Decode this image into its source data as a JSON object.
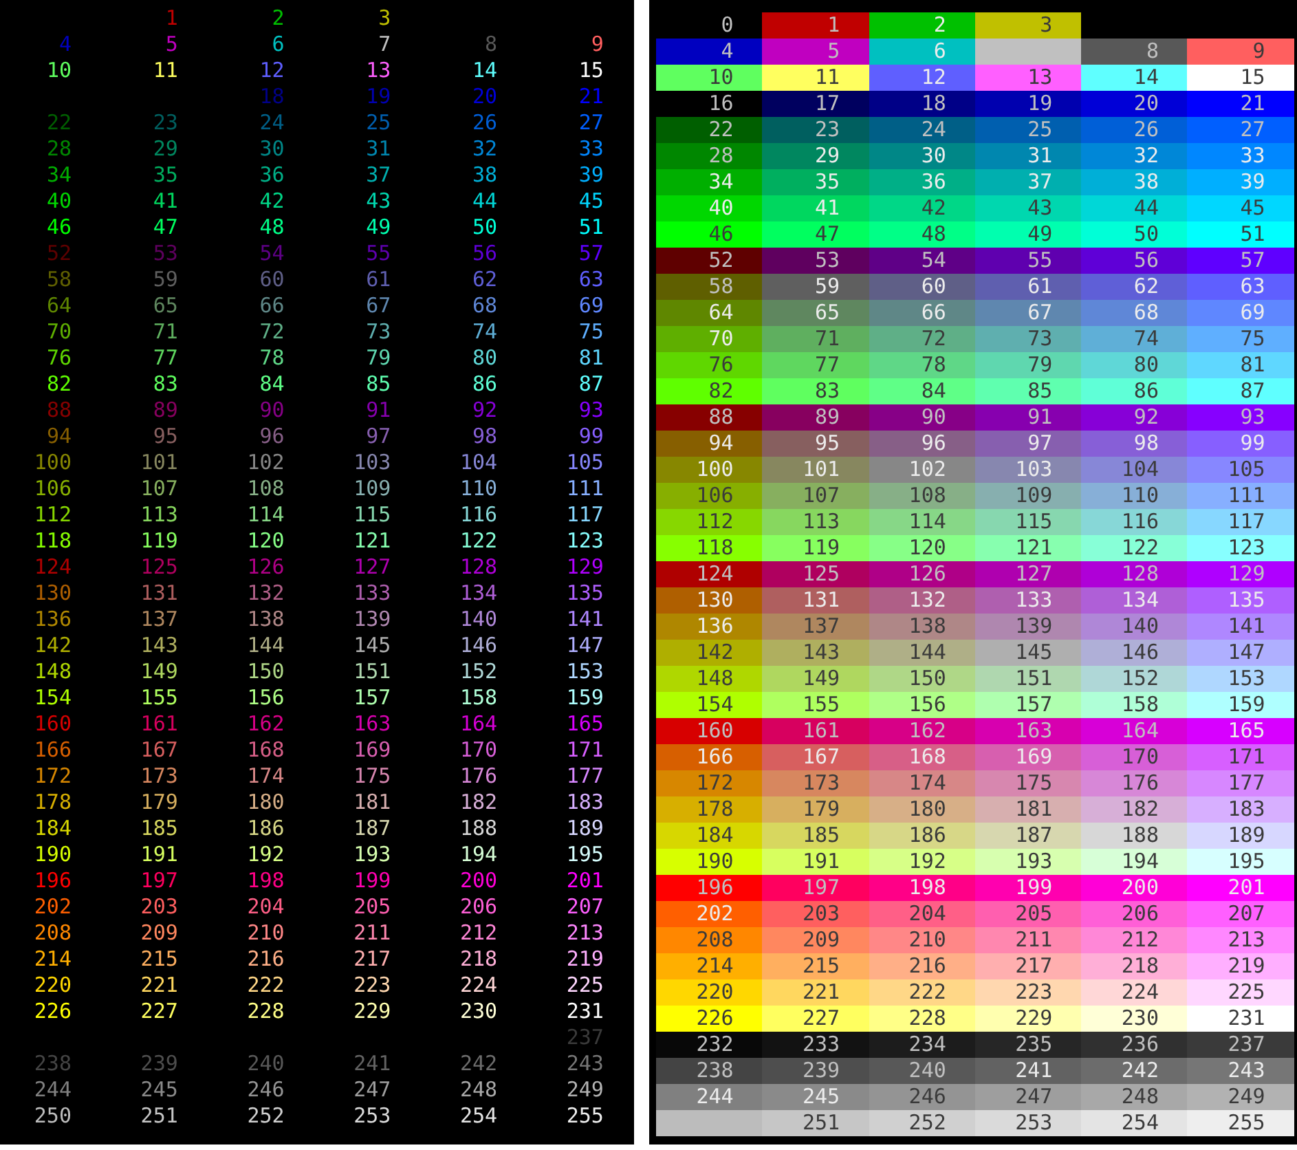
{
  "foreground_panel": {
    "cells": [
      null,
      {
        "text": "1",
        "color": "#c00000"
      },
      {
        "text": "2",
        "color": "#00c000"
      },
      {
        "text": "3",
        "color": "#c0c000"
      },
      {
        "text": "4",
        "color": "#0000c0"
      },
      {
        "text": "5",
        "color": "#c000c0"
      },
      {
        "text": "6",
        "color": "#00c0c0"
      },
      {
        "text": "7",
        "color": "#c0c0c0"
      },
      {
        "text": "8",
        "color": "#585858"
      },
      {
        "text": "9",
        "color": "#ff5f5f"
      },
      {
        "text": "10",
        "color": "#5fff5f"
      },
      {
        "text": "11",
        "color": "#ffff5f"
      },
      {
        "text": "12",
        "color": "#5f5fff"
      },
      {
        "text": "13",
        "color": "#ff5fff"
      },
      {
        "text": "14",
        "color": "#5fffff"
      },
      {
        "text": "15",
        "color": "#ffffff"
      },
      null,
      null,
      {
        "text": "18",
        "color": "#000087"
      },
      {
        "text": "19",
        "color": "#0000af"
      },
      {
        "text": "20",
        "color": "#0000d7"
      },
      {
        "text": "21",
        "color": "#0000ff"
      },
      {
        "text": "22",
        "color": "#005f00"
      },
      {
        "text": "23",
        "color": "#005f5f"
      },
      {
        "text": "24",
        "color": "#005f87"
      },
      {
        "text": "25",
        "color": "#005faf"
      },
      {
        "text": "26",
        "color": "#005fd7"
      },
      {
        "text": "27",
        "color": "#005fff"
      },
      {
        "text": "28",
        "color": "#008700"
      },
      {
        "text": "29",
        "color": "#00875f"
      },
      {
        "text": "30",
        "color": "#008787"
      },
      {
        "text": "31",
        "color": "#0087af"
      },
      {
        "text": "32",
        "color": "#0087d7"
      },
      {
        "text": "33",
        "color": "#0087ff"
      },
      {
        "text": "34",
        "color": "#00af00"
      },
      {
        "text": "35",
        "color": "#00af5f"
      },
      {
        "text": "36",
        "color": "#00af87"
      },
      {
        "text": "37",
        "color": "#00afaf"
      },
      {
        "text": "38",
        "color": "#00afd7"
      },
      {
        "text": "39",
        "color": "#00afff"
      },
      {
        "text": "40",
        "color": "#00d700"
      },
      {
        "text": "41",
        "color": "#00d75f"
      },
      {
        "text": "42",
        "color": "#00d787"
      },
      {
        "text": "43",
        "color": "#00d7af"
      },
      {
        "text": "44",
        "color": "#00d7d7"
      },
      {
        "text": "45",
        "color": "#00d7ff"
      },
      {
        "text": "46",
        "color": "#00ff00"
      },
      {
        "text": "47",
        "color": "#00ff5f"
      },
      {
        "text": "48",
        "color": "#00ff87"
      },
      {
        "text": "49",
        "color": "#00ffaf"
      },
      {
        "text": "50",
        "color": "#00ffd7"
      },
      {
        "text": "51",
        "color": "#00ffff"
      },
      {
        "text": "52",
        "color": "#5f0000"
      },
      {
        "text": "53",
        "color": "#5f005f"
      },
      {
        "text": "54",
        "color": "#5f0087"
      },
      {
        "text": "55",
        "color": "#5f00af"
      },
      {
        "text": "56",
        "color": "#5f00d7"
      },
      {
        "text": "57",
        "color": "#5f00ff"
      },
      {
        "text": "58",
        "color": "#5f5f00"
      },
      {
        "text": "59",
        "color": "#5f5f5f"
      },
      {
        "text": "60",
        "color": "#5f5f87"
      },
      {
        "text": "61",
        "color": "#5f5faf"
      },
      {
        "text": "62",
        "color": "#5f5fd7"
      },
      {
        "text": "63",
        "color": "#5f5fff"
      },
      {
        "text": "64",
        "color": "#5f8700"
      },
      {
        "text": "65",
        "color": "#5f875f"
      },
      {
        "text": "66",
        "color": "#5f8787"
      },
      {
        "text": "67",
        "color": "#5f87af"
      },
      {
        "text": "68",
        "color": "#5f87d7"
      },
      {
        "text": "69",
        "color": "#5f87ff"
      },
      {
        "text": "70",
        "color": "#5faf00"
      },
      {
        "text": "71",
        "color": "#5faf5f"
      },
      {
        "text": "72",
        "color": "#5faf87"
      },
      {
        "text": "73",
        "color": "#5fafaf"
      },
      {
        "text": "74",
        "color": "#5fafd7"
      },
      {
        "text": "75",
        "color": "#5fafff"
      },
      {
        "text": "76",
        "color": "#5fd700"
      },
      {
        "text": "77",
        "color": "#5fd75f"
      },
      {
        "text": "78",
        "color": "#5fd787"
      },
      {
        "text": "79",
        "color": "#5fd7af"
      },
      {
        "text": "80",
        "color": "#5fd7d7"
      },
      {
        "text": "81",
        "color": "#5fd7ff"
      },
      {
        "text": "82",
        "color": "#5fff00"
      },
      {
        "text": "83",
        "color": "#5fff5f"
      },
      {
        "text": "84",
        "color": "#5fff87"
      },
      {
        "text": "85",
        "color": "#5fffaf"
      },
      {
        "text": "86",
        "color": "#5fffd7"
      },
      {
        "text": "87",
        "color": "#5fffff"
      },
      {
        "text": "88",
        "color": "#870000"
      },
      {
        "text": "89",
        "color": "#87005f"
      },
      {
        "text": "90",
        "color": "#870087"
      },
      {
        "text": "91",
        "color": "#8700af"
      },
      {
        "text": "92",
        "color": "#8700d7"
      },
      {
        "text": "93",
        "color": "#8700ff"
      },
      {
        "text": "94",
        "color": "#875f00"
      },
      {
        "text": "95",
        "color": "#875f5f"
      },
      {
        "text": "96",
        "color": "#875f87"
      },
      {
        "text": "97",
        "color": "#875faf"
      },
      {
        "text": "98",
        "color": "#875fd7"
      },
      {
        "text": "99",
        "color": "#875fff"
      },
      {
        "text": "100",
        "color": "#878700"
      },
      {
        "text": "101",
        "color": "#87875f"
      },
      {
        "text": "102",
        "color": "#878787"
      },
      {
        "text": "103",
        "color": "#8787af"
      },
      {
        "text": "104",
        "color": "#8787d7"
      },
      {
        "text": "105",
        "color": "#8787ff"
      },
      {
        "text": "106",
        "color": "#87af00"
      },
      {
        "text": "107",
        "color": "#87af5f"
      },
      {
        "text": "108",
        "color": "#87af87"
      },
      {
        "text": "109",
        "color": "#87afaf"
      },
      {
        "text": "110",
        "color": "#87afd7"
      },
      {
        "text": "111",
        "color": "#87afff"
      },
      {
        "text": "112",
        "color": "#87d700"
      },
      {
        "text": "113",
        "color": "#87d75f"
      },
      {
        "text": "114",
        "color": "#87d787"
      },
      {
        "text": "115",
        "color": "#87d7af"
      },
      {
        "text": "116",
        "color": "#87d7d7"
      },
      {
        "text": "117",
        "color": "#87d7ff"
      },
      {
        "text": "118",
        "color": "#87ff00"
      },
      {
        "text": "119",
        "color": "#87ff5f"
      },
      {
        "text": "120",
        "color": "#87ff87"
      },
      {
        "text": "121",
        "color": "#87ffaf"
      },
      {
        "text": "122",
        "color": "#87ffd7"
      },
      {
        "text": "123",
        "color": "#87ffff"
      },
      {
        "text": "124",
        "color": "#af0000"
      },
      {
        "text": "125",
        "color": "#af005f"
      },
      {
        "text": "126",
        "color": "#af0087"
      },
      {
        "text": "127",
        "color": "#af00af"
      },
      {
        "text": "128",
        "color": "#af00d7"
      },
      {
        "text": "129",
        "color": "#af00ff"
      },
      {
        "text": "130",
        "color": "#af5f00"
      },
      {
        "text": "131",
        "color": "#af5f5f"
      },
      {
        "text": "132",
        "color": "#af5f87"
      },
      {
        "text": "133",
        "color": "#af5faf"
      },
      {
        "text": "134",
        "color": "#af5fd7"
      },
      {
        "text": "135",
        "color": "#af5fff"
      },
      {
        "text": "136",
        "color": "#af8700"
      },
      {
        "text": "137",
        "color": "#af875f"
      },
      {
        "text": "138",
        "color": "#af8787"
      },
      {
        "text": "139",
        "color": "#af87af"
      },
      {
        "text": "140",
        "color": "#af87d7"
      },
      {
        "text": "141",
        "color": "#af87ff"
      },
      {
        "text": "142",
        "color": "#afaf00"
      },
      {
        "text": "143",
        "color": "#afaf5f"
      },
      {
        "text": "144",
        "color": "#afaf87"
      },
      {
        "text": "145",
        "color": "#afafaf"
      },
      {
        "text": "146",
        "color": "#afafd7"
      },
      {
        "text": "147",
        "color": "#afafff"
      },
      {
        "text": "148",
        "color": "#afd700"
      },
      {
        "text": "149",
        "color": "#afd75f"
      },
      {
        "text": "150",
        "color": "#afd787"
      },
      {
        "text": "151",
        "color": "#afd7af"
      },
      {
        "text": "152",
        "color": "#afd7d7"
      },
      {
        "text": "153",
        "color": "#afd7ff"
      },
      {
        "text": "154",
        "color": "#afff00"
      },
      {
        "text": "155",
        "color": "#afff5f"
      },
      {
        "text": "156",
        "color": "#afff87"
      },
      {
        "text": "157",
        "color": "#afffaf"
      },
      {
        "text": "158",
        "color": "#afffd7"
      },
      {
        "text": "159",
        "color": "#afffff"
      },
      {
        "text": "160",
        "color": "#d70000"
      },
      {
        "text": "161",
        "color": "#d7005f"
      },
      {
        "text": "162",
        "color": "#d70087"
      },
      {
        "text": "163",
        "color": "#d700af"
      },
      {
        "text": "164",
        "color": "#d700d7"
      },
      {
        "text": "165",
        "color": "#d700ff"
      },
      {
        "text": "166",
        "color": "#d75f00"
      },
      {
        "text": "167",
        "color": "#d75f5f"
      },
      {
        "text": "168",
        "color": "#d75f87"
      },
      {
        "text": "169",
        "color": "#d75faf"
      },
      {
        "text": "170",
        "color": "#d75fd7"
      },
      {
        "text": "171",
        "color": "#d75fff"
      },
      {
        "text": "172",
        "color": "#d78700"
      },
      {
        "text": "173",
        "color": "#d7875f"
      },
      {
        "text": "174",
        "color": "#d78787"
      },
      {
        "text": "175",
        "color": "#d787af"
      },
      {
        "text": "176",
        "color": "#d787d7"
      },
      {
        "text": "177",
        "color": "#d787ff"
      },
      {
        "text": "178",
        "color": "#d7af00"
      },
      {
        "text": "179",
        "color": "#d7af5f"
      },
      {
        "text": "180",
        "color": "#d7af87"
      },
      {
        "text": "181",
        "color": "#d7afaf"
      },
      {
        "text": "182",
        "color": "#d7afd7"
      },
      {
        "text": "183",
        "color": "#d7afff"
      },
      {
        "text": "184",
        "color": "#d7d700"
      },
      {
        "text": "185",
        "color": "#d7d75f"
      },
      {
        "text": "186",
        "color": "#d7d787"
      },
      {
        "text": "187",
        "color": "#d7d7af"
      },
      {
        "text": "188",
        "color": "#d7d7d7"
      },
      {
        "text": "189",
        "color": "#d7d7ff"
      },
      {
        "text": "190",
        "color": "#d7ff00"
      },
      {
        "text": "191",
        "color": "#d7ff5f"
      },
      {
        "text": "192",
        "color": "#d7ff87"
      },
      {
        "text": "193",
        "color": "#d7ffaf"
      },
      {
        "text": "194",
        "color": "#d7ffd7"
      },
      {
        "text": "195",
        "color": "#d7ffff"
      },
      {
        "text": "196",
        "color": "#ff0000"
      },
      {
        "text": "197",
        "color": "#ff005f"
      },
      {
        "text": "198",
        "color": "#ff0087"
      },
      {
        "text": "199",
        "color": "#ff00af"
      },
      {
        "text": "200",
        "color": "#ff00d7"
      },
      {
        "text": "201",
        "color": "#ff00ff"
      },
      {
        "text": "202",
        "color": "#ff5f00"
      },
      {
        "text": "203",
        "color": "#ff5f5f"
      },
      {
        "text": "204",
        "color": "#ff5f87"
      },
      {
        "text": "205",
        "color": "#ff5faf"
      },
      {
        "text": "206",
        "color": "#ff5fd7"
      },
      {
        "text": "207",
        "color": "#ff5fff"
      },
      {
        "text": "208",
        "color": "#ff8700"
      },
      {
        "text": "209",
        "color": "#ff875f"
      },
      {
        "text": "210",
        "color": "#ff8787"
      },
      {
        "text": "211",
        "color": "#ff87af"
      },
      {
        "text": "212",
        "color": "#ff87d7"
      },
      {
        "text": "213",
        "color": "#ff87ff"
      },
      {
        "text": "214",
        "color": "#ffaf00"
      },
      {
        "text": "215",
        "color": "#ffaf5f"
      },
      {
        "text": "216",
        "color": "#ffaf87"
      },
      {
        "text": "217",
        "color": "#ffafaf"
      },
      {
        "text": "218",
        "color": "#ffafd7"
      },
      {
        "text": "219",
        "color": "#ffafff"
      },
      {
        "text": "220",
        "color": "#ffd700"
      },
      {
        "text": "221",
        "color": "#ffd75f"
      },
      {
        "text": "222",
        "color": "#ffd787"
      },
      {
        "text": "223",
        "color": "#ffd7af"
      },
      {
        "text": "224",
        "color": "#ffd7d7"
      },
      {
        "text": "225",
        "color": "#ffd7ff"
      },
      {
        "text": "226",
        "color": "#ffff00"
      },
      {
        "text": "227",
        "color": "#ffff5f"
      },
      {
        "text": "228",
        "color": "#ffff87"
      },
      {
        "text": "229",
        "color": "#ffffaf"
      },
      {
        "text": "230",
        "color": "#ffffd7"
      },
      {
        "text": "231",
        "color": "#ffffff"
      },
      null,
      null,
      null,
      null,
      null,
      {
        "text": "237",
        "color": "#3a3a3a"
      },
      {
        "text": "238",
        "color": "#444444"
      },
      {
        "text": "239",
        "color": "#4e4e4e"
      },
      {
        "text": "240",
        "color": "#585858"
      },
      {
        "text": "241",
        "color": "#626262"
      },
      {
        "text": "242",
        "color": "#6c6c6c"
      },
      {
        "text": "243",
        "color": "#767676"
      },
      {
        "text": "244",
        "color": "#808080"
      },
      {
        "text": "245",
        "color": "#8a8a8a"
      },
      {
        "text": "246",
        "color": "#949494"
      },
      {
        "text": "247",
        "color": "#9e9e9e"
      },
      {
        "text": "248",
        "color": "#a8a8a8"
      },
      {
        "text": "249",
        "color": "#b2b2b2"
      },
      {
        "text": "250",
        "color": "#bcbcbc"
      },
      {
        "text": "251",
        "color": "#c6c6c6"
      },
      {
        "text": "252",
        "color": "#d0d0d0"
      },
      {
        "text": "253",
        "color": "#dadada"
      },
      {
        "text": "254",
        "color": "#e4e4e4"
      },
      {
        "text": "255",
        "color": "#eeeeee"
      }
    ]
  },
  "background_panel": {
    "cells": [
      {
        "text": "0",
        "color": "#000000"
      },
      {
        "text": "1",
        "color": "#c00000"
      },
      {
        "text": "2",
        "color": "#00c000"
      },
      {
        "text": "3",
        "color": "#c0c000"
      },
      {
        "text": "4",
        "color": "#0000c0"
      },
      {
        "text": "5",
        "color": "#c000c0"
      },
      {
        "text": "6",
        "color": "#00c0c0"
      },
      {
        "color": "#c0c0c0"
      },
      {
        "text": "8",
        "color": "#585858"
      },
      {
        "text": "9",
        "color": "#ff5f5f"
      },
      {
        "text": "10",
        "color": "#5fff5f"
      },
      {
        "text": "11",
        "color": "#ffff5f"
      },
      {
        "text": "12",
        "color": "#5f5fff"
      },
      {
        "text": "13",
        "color": "#ff5fff"
      },
      {
        "text": "14",
        "color": "#5fffff"
      },
      {
        "text": "15",
        "color": "#ffffff"
      },
      {
        "text": "16",
        "color": "#000000"
      },
      {
        "text": "17",
        "color": "#00005f"
      },
      {
        "text": "18",
        "color": "#000087"
      },
      {
        "text": "19",
        "color": "#0000af"
      },
      {
        "text": "20",
        "color": "#0000d7"
      },
      {
        "text": "21",
        "color": "#0000ff"
      },
      {
        "text": "22",
        "color": "#005f00"
      },
      {
        "text": "23",
        "color": "#005f5f"
      },
      {
        "text": "24",
        "color": "#005f87"
      },
      {
        "text": "25",
        "color": "#005faf"
      },
      {
        "text": "26",
        "color": "#005fd7"
      },
      {
        "text": "27",
        "color": "#005fff"
      },
      {
        "text": "28",
        "color": "#008700"
      },
      {
        "text": "29",
        "color": "#00875f"
      },
      {
        "text": "30",
        "color": "#008787"
      },
      {
        "text": "31",
        "color": "#0087af"
      },
      {
        "text": "32",
        "color": "#0087d7"
      },
      {
        "text": "33",
        "color": "#0087ff"
      },
      {
        "text": "34",
        "color": "#00af00"
      },
      {
        "text": "35",
        "color": "#00af5f"
      },
      {
        "text": "36",
        "color": "#00af87"
      },
      {
        "text": "37",
        "color": "#00afaf"
      },
      {
        "text": "38",
        "color": "#00afd7"
      },
      {
        "text": "39",
        "color": "#00afff"
      },
      {
        "text": "40",
        "color": "#00d700"
      },
      {
        "text": "41",
        "color": "#00d75f"
      },
      {
        "text": "42",
        "color": "#00d787"
      },
      {
        "text": "43",
        "color": "#00d7af"
      },
      {
        "text": "44",
        "color": "#00d7d7"
      },
      {
        "text": "45",
        "color": "#00d7ff"
      },
      {
        "text": "46",
        "color": "#00ff00"
      },
      {
        "text": "47",
        "color": "#00ff5f"
      },
      {
        "text": "48",
        "color": "#00ff87"
      },
      {
        "text": "49",
        "color": "#00ffaf"
      },
      {
        "text": "50",
        "color": "#00ffd7"
      },
      {
        "text": "51",
        "color": "#00ffff"
      },
      {
        "text": "52",
        "color": "#5f0000"
      },
      {
        "text": "53",
        "color": "#5f005f"
      },
      {
        "text": "54",
        "color": "#5f0087"
      },
      {
        "text": "55",
        "color": "#5f00af"
      },
      {
        "text": "56",
        "color": "#5f00d7"
      },
      {
        "text": "57",
        "color": "#5f00ff"
      },
      {
        "text": "58",
        "color": "#5f5f00"
      },
      {
        "text": "59",
        "color": "#5f5f5f"
      },
      {
        "text": "60",
        "color": "#5f5f87"
      },
      {
        "text": "61",
        "color": "#5f5faf"
      },
      {
        "text": "62",
        "color": "#5f5fd7"
      },
      {
        "text": "63",
        "color": "#5f5fff"
      },
      {
        "text": "64",
        "color": "#5f8700"
      },
      {
        "text": "65",
        "color": "#5f875f"
      },
      {
        "text": "66",
        "color": "#5f8787"
      },
      {
        "text": "67",
        "color": "#5f87af"
      },
      {
        "text": "68",
        "color": "#5f87d7"
      },
      {
        "text": "69",
        "color": "#5f87ff"
      },
      {
        "text": "70",
        "color": "#5faf00"
      },
      {
        "text": "71",
        "color": "#5faf5f"
      },
      {
        "text": "72",
        "color": "#5faf87"
      },
      {
        "text": "73",
        "color": "#5fafaf"
      },
      {
        "text": "74",
        "color": "#5fafd7"
      },
      {
        "text": "75",
        "color": "#5fafff"
      },
      {
        "text": "76",
        "color": "#5fd700"
      },
      {
        "text": "77",
        "color": "#5fd75f"
      },
      {
        "text": "78",
        "color": "#5fd787"
      },
      {
        "text": "79",
        "color": "#5fd7af"
      },
      {
        "text": "80",
        "color": "#5fd7d7"
      },
      {
        "text": "81",
        "color": "#5fd7ff"
      },
      {
        "text": "82",
        "color": "#5fff00"
      },
      {
        "text": "83",
        "color": "#5fff5f"
      },
      {
        "text": "84",
        "color": "#5fff87"
      },
      {
        "text": "85",
        "color": "#5fffaf"
      },
      {
        "text": "86",
        "color": "#5fffd7"
      },
      {
        "text": "87",
        "color": "#5fffff"
      },
      {
        "text": "88",
        "color": "#870000"
      },
      {
        "text": "89",
        "color": "#87005f"
      },
      {
        "text": "90",
        "color": "#870087"
      },
      {
        "text": "91",
        "color": "#8700af"
      },
      {
        "text": "92",
        "color": "#8700d7"
      },
      {
        "text": "93",
        "color": "#8700ff"
      },
      {
        "text": "94",
        "color": "#875f00"
      },
      {
        "text": "95",
        "color": "#875f5f"
      },
      {
        "text": "96",
        "color": "#875f87"
      },
      {
        "text": "97",
        "color": "#875faf"
      },
      {
        "text": "98",
        "color": "#875fd7"
      },
      {
        "text": "99",
        "color": "#875fff"
      },
      {
        "text": "100",
        "color": "#878700"
      },
      {
        "text": "101",
        "color": "#87875f"
      },
      {
        "text": "102",
        "color": "#878787"
      },
      {
        "text": "103",
        "color": "#8787af"
      },
      {
        "text": "104",
        "color": "#8787d7"
      },
      {
        "text": "105",
        "color": "#8787ff"
      },
      {
        "text": "106",
        "color": "#87af00"
      },
      {
        "text": "107",
        "color": "#87af5f"
      },
      {
        "text": "108",
        "color": "#87af87"
      },
      {
        "text": "109",
        "color": "#87afaf"
      },
      {
        "text": "110",
        "color": "#87afd7"
      },
      {
        "text": "111",
        "color": "#87afff"
      },
      {
        "text": "112",
        "color": "#87d700"
      },
      {
        "text": "113",
        "color": "#87d75f"
      },
      {
        "text": "114",
        "color": "#87d787"
      },
      {
        "text": "115",
        "color": "#87d7af"
      },
      {
        "text": "116",
        "color": "#87d7d7"
      },
      {
        "text": "117",
        "color": "#87d7ff"
      },
      {
        "text": "118",
        "color": "#87ff00"
      },
      {
        "text": "119",
        "color": "#87ff5f"
      },
      {
        "text": "120",
        "color": "#87ff87"
      },
      {
        "text": "121",
        "color": "#87ffaf"
      },
      {
        "text": "122",
        "color": "#87ffd7"
      },
      {
        "text": "123",
        "color": "#87ffff"
      },
      {
        "text": "124",
        "color": "#af0000"
      },
      {
        "text": "125",
        "color": "#af005f"
      },
      {
        "text": "126",
        "color": "#af0087"
      },
      {
        "text": "127",
        "color": "#af00af"
      },
      {
        "text": "128",
        "color": "#af00d7"
      },
      {
        "text": "129",
        "color": "#af00ff"
      },
      {
        "text": "130",
        "color": "#af5f00"
      },
      {
        "text": "131",
        "color": "#af5f5f"
      },
      {
        "text": "132",
        "color": "#af5f87"
      },
      {
        "text": "133",
        "color": "#af5faf"
      },
      {
        "text": "134",
        "color": "#af5fd7"
      },
      {
        "text": "135",
        "color": "#af5fff"
      },
      {
        "text": "136",
        "color": "#af8700"
      },
      {
        "text": "137",
        "color": "#af875f"
      },
      {
        "text": "138",
        "color": "#af8787"
      },
      {
        "text": "139",
        "color": "#af87af"
      },
      {
        "text": "140",
        "color": "#af87d7"
      },
      {
        "text": "141",
        "color": "#af87ff"
      },
      {
        "text": "142",
        "color": "#afaf00"
      },
      {
        "text": "143",
        "color": "#afaf5f"
      },
      {
        "text": "144",
        "color": "#afaf87"
      },
      {
        "text": "145",
        "color": "#afafaf"
      },
      {
        "text": "146",
        "color": "#afafd7"
      },
      {
        "text": "147",
        "color": "#afafff"
      },
      {
        "text": "148",
        "color": "#afd700"
      },
      {
        "text": "149",
        "color": "#afd75f"
      },
      {
        "text": "150",
        "color": "#afd787"
      },
      {
        "text": "151",
        "color": "#afd7af"
      },
      {
        "text": "152",
        "color": "#afd7d7"
      },
      {
        "text": "153",
        "color": "#afd7ff"
      },
      {
        "text": "154",
        "color": "#afff00"
      },
      {
        "text": "155",
        "color": "#afff5f"
      },
      {
        "text": "156",
        "color": "#afff87"
      },
      {
        "text": "157",
        "color": "#afffaf"
      },
      {
        "text": "158",
        "color": "#afffd7"
      },
      {
        "text": "159",
        "color": "#afffff"
      },
      {
        "text": "160",
        "color": "#d70000"
      },
      {
        "text": "161",
        "color": "#d7005f"
      },
      {
        "text": "162",
        "color": "#d70087"
      },
      {
        "text": "163",
        "color": "#d700af"
      },
      {
        "text": "164",
        "color": "#d700d7"
      },
      {
        "text": "165",
        "color": "#d700ff"
      },
      {
        "text": "166",
        "color": "#d75f00"
      },
      {
        "text": "167",
        "color": "#d75f5f"
      },
      {
        "text": "168",
        "color": "#d75f87"
      },
      {
        "text": "169",
        "color": "#d75faf"
      },
      {
        "text": "170",
        "color": "#d75fd7"
      },
      {
        "text": "171",
        "color": "#d75fff"
      },
      {
        "text": "172",
        "color": "#d78700"
      },
      {
        "text": "173",
        "color": "#d7875f"
      },
      {
        "text": "174",
        "color": "#d78787"
      },
      {
        "text": "175",
        "color": "#d787af"
      },
      {
        "text": "176",
        "color": "#d787d7"
      },
      {
        "text": "177",
        "color": "#d787ff"
      },
      {
        "text": "178",
        "color": "#d7af00"
      },
      {
        "text": "179",
        "color": "#d7af5f"
      },
      {
        "text": "180",
        "color": "#d7af87"
      },
      {
        "text": "181",
        "color": "#d7afaf"
      },
      {
        "text": "182",
        "color": "#d7afd7"
      },
      {
        "text": "183",
        "color": "#d7afff"
      },
      {
        "text": "184",
        "color": "#d7d700"
      },
      {
        "text": "185",
        "color": "#d7d75f"
      },
      {
        "text": "186",
        "color": "#d7d787"
      },
      {
        "text": "187",
        "color": "#d7d7af"
      },
      {
        "text": "188",
        "color": "#d7d7d7"
      },
      {
        "text": "189",
        "color": "#d7d7ff"
      },
      {
        "text": "190",
        "color": "#d7ff00"
      },
      {
        "text": "191",
        "color": "#d7ff5f"
      },
      {
        "text": "192",
        "color": "#d7ff87"
      },
      {
        "text": "193",
        "color": "#d7ffaf"
      },
      {
        "text": "194",
        "color": "#d7ffd7"
      },
      {
        "text": "195",
        "color": "#d7ffff"
      },
      {
        "text": "196",
        "color": "#ff0000"
      },
      {
        "text": "197",
        "color": "#ff005f"
      },
      {
        "text": "198",
        "color": "#ff0087"
      },
      {
        "text": "199",
        "color": "#ff00af"
      },
      {
        "text": "200",
        "color": "#ff00d7"
      },
      {
        "text": "201",
        "color": "#ff00ff"
      },
      {
        "text": "202",
        "color": "#ff5f00"
      },
      {
        "text": "203",
        "color": "#ff5f5f"
      },
      {
        "text": "204",
        "color": "#ff5f87"
      },
      {
        "text": "205",
        "color": "#ff5faf"
      },
      {
        "text": "206",
        "color": "#ff5fd7"
      },
      {
        "text": "207",
        "color": "#ff5fff"
      },
      {
        "text": "208",
        "color": "#ff8700"
      },
      {
        "text": "209",
        "color": "#ff875f"
      },
      {
        "text": "210",
        "color": "#ff8787"
      },
      {
        "text": "211",
        "color": "#ff87af"
      },
      {
        "text": "212",
        "color": "#ff87d7"
      },
      {
        "text": "213",
        "color": "#ff87ff"
      },
      {
        "text": "214",
        "color": "#ffaf00"
      },
      {
        "text": "215",
        "color": "#ffaf5f"
      },
      {
        "text": "216",
        "color": "#ffaf87"
      },
      {
        "text": "217",
        "color": "#ffafaf"
      },
      {
        "text": "218",
        "color": "#ffafd7"
      },
      {
        "text": "219",
        "color": "#ffafff"
      },
      {
        "text": "220",
        "color": "#ffd700"
      },
      {
        "text": "221",
        "color": "#ffd75f"
      },
      {
        "text": "222",
        "color": "#ffd787"
      },
      {
        "text": "223",
        "color": "#ffd7af"
      },
      {
        "text": "224",
        "color": "#ffd7d7"
      },
      {
        "text": "225",
        "color": "#ffd7ff"
      },
      {
        "text": "226",
        "color": "#ffff00"
      },
      {
        "text": "227",
        "color": "#ffff5f"
      },
      {
        "text": "228",
        "color": "#ffff87"
      },
      {
        "text": "229",
        "color": "#ffffaf"
      },
      {
        "text": "230",
        "color": "#ffffd7"
      },
      {
        "text": "231",
        "color": "#ffffff"
      },
      {
        "text": "232",
        "color": "#080808"
      },
      {
        "text": "233",
        "color": "#121212"
      },
      {
        "text": "234",
        "color": "#1c1c1c"
      },
      {
        "text": "235",
        "color": "#262626"
      },
      {
        "text": "236",
        "color": "#303030"
      },
      {
        "text": "237",
        "color": "#3a3a3a"
      },
      {
        "text": "238",
        "color": "#444444"
      },
      {
        "text": "239",
        "color": "#4e4e4e"
      },
      {
        "text": "240",
        "color": "#585858"
      },
      {
        "text": "241",
        "color": "#626262"
      },
      {
        "text": "242",
        "color": "#6c6c6c"
      },
      {
        "text": "243",
        "color": "#767676"
      },
      {
        "text": "244",
        "color": "#808080"
      },
      {
        "text": "245",
        "color": "#8a8a8a"
      },
      {
        "text": "246",
        "color": "#949494"
      },
      {
        "text": "247",
        "color": "#9e9e9e"
      },
      {
        "text": "248",
        "color": "#a8a8a8"
      },
      {
        "text": "249",
        "color": "#b2b2b2"
      },
      {
        "color": "#bcbcbc"
      },
      {
        "text": "251",
        "color": "#c6c6c6"
      },
      {
        "text": "252",
        "color": "#d0d0d0"
      },
      {
        "text": "253",
        "color": "#dadada"
      },
      {
        "text": "254",
        "color": "#e4e4e4"
      },
      {
        "text": "255",
        "color": "#eeeeee"
      }
    ]
  }
}
